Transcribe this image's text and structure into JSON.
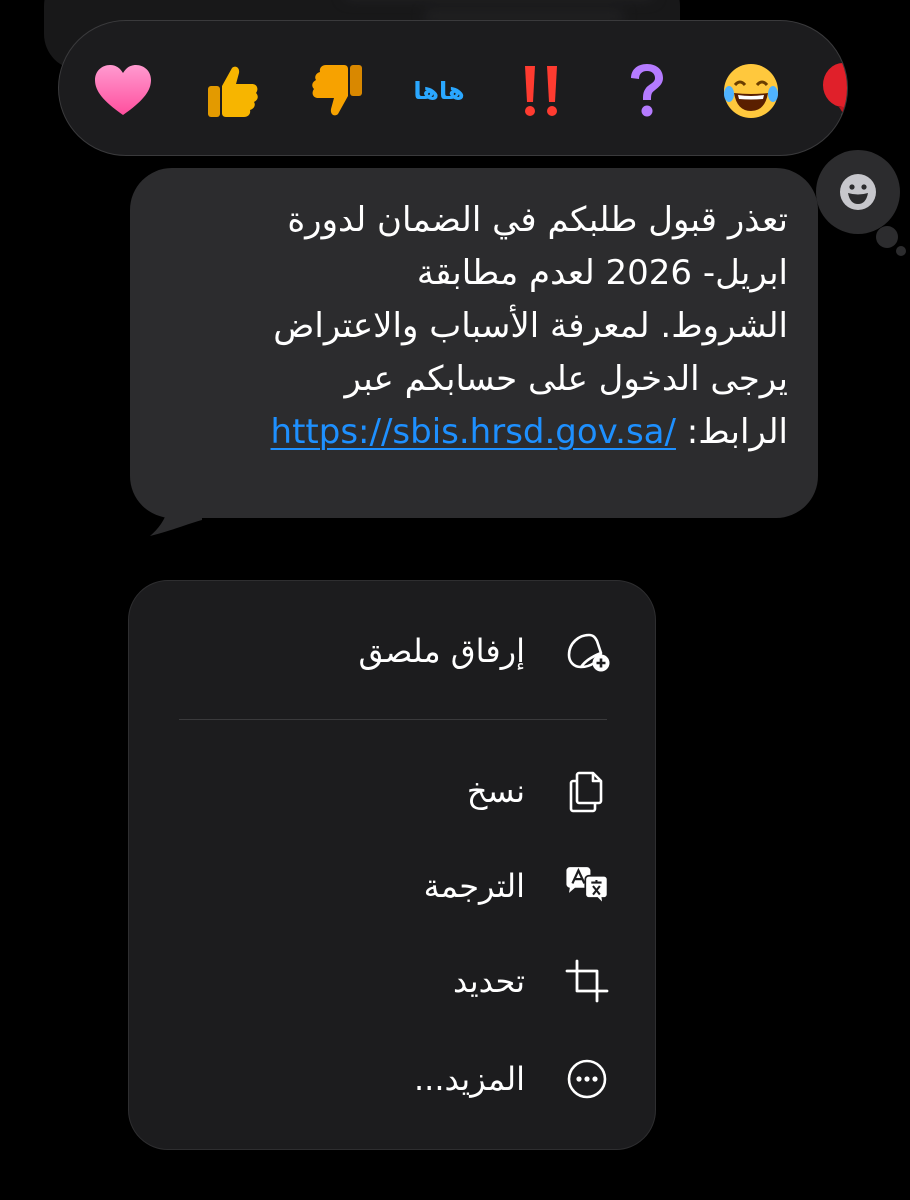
{
  "message": {
    "lines": [
      "تعذر قبول طلبكم في الضمان لدورة",
      "ابريل- 2026  لعدم مطابقة",
      "الشروط. لمعرفة الأسباب والاعتراض",
      "يرجى الدخول على حسابكم عبر"
    ],
    "last_line_prefix": "الرابط: ",
    "link": "https://sbis.hrsd.gov.sa/"
  },
  "reactions": [
    {
      "icon": "heart-icon",
      "color": "#ff6fb5"
    },
    {
      "icon": "thumbs-up-icon",
      "color": "#f7b500"
    },
    {
      "icon": "thumbs-down-icon",
      "color": "#f7a200"
    },
    {
      "icon": "haha-text",
      "label": "هاها",
      "color": "#2aa7ff"
    },
    {
      "icon": "double-exclamation-icon",
      "color": "#ff3b30"
    },
    {
      "icon": "question-icon",
      "color": "#b57bff"
    },
    {
      "icon": "laughing-face-icon",
      "color": "#ffc83d"
    },
    {
      "icon": "red-balloon-icon",
      "color": "#e0202a"
    }
  ],
  "menu": {
    "sticker": {
      "label": "إرفاق ملصق",
      "icon": "sticker-add-icon"
    },
    "copy": {
      "label": "نسخ",
      "icon": "copy-icon"
    },
    "translate": {
      "label": "الترجمة",
      "icon": "translate-icon"
    },
    "select": {
      "label": "تحديد",
      "icon": "crop-select-icon"
    },
    "more": {
      "label": "المزيد...",
      "icon": "more-ellipsis-icon"
    }
  },
  "colors": {
    "background": "#000000",
    "bubble": "#2c2c2e",
    "menu": "#1c1c1e",
    "link": "#1e90ff"
  }
}
